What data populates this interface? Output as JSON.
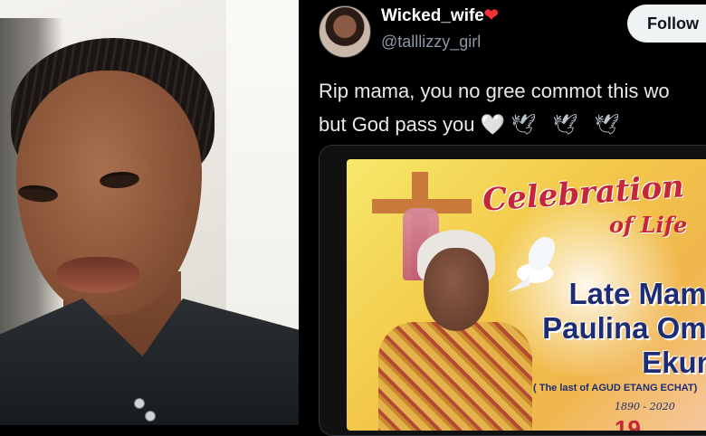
{
  "tweet": {
    "display_name": "Wicked_wife",
    "heart_emoji": "❤",
    "handle": "@talllizzy_girl",
    "follow_label": "Follow",
    "text_line1": "Rip mama, you no gree commot this wo",
    "text_line2": "but God pass you",
    "white_heart": "🤍",
    "doves": "🕊 🕊 🕊"
  },
  "poster": {
    "title": "Celebration",
    "subtitle": "of Life",
    "name_line1": "Late Mama",
    "name_line2": "Paulina Oma",
    "name_line3": "Ekum",
    "caption": "( The last of AGUD ETANG ECHAT)",
    "years": "1890 - 2020",
    "big_number": "19"
  },
  "colors": {
    "background": "#000000",
    "follow_button_bg": "#eff3f4",
    "handle_gray": "#8b98a5",
    "poster_red": "#c7253a",
    "poster_navy": "#1e2c74"
  }
}
